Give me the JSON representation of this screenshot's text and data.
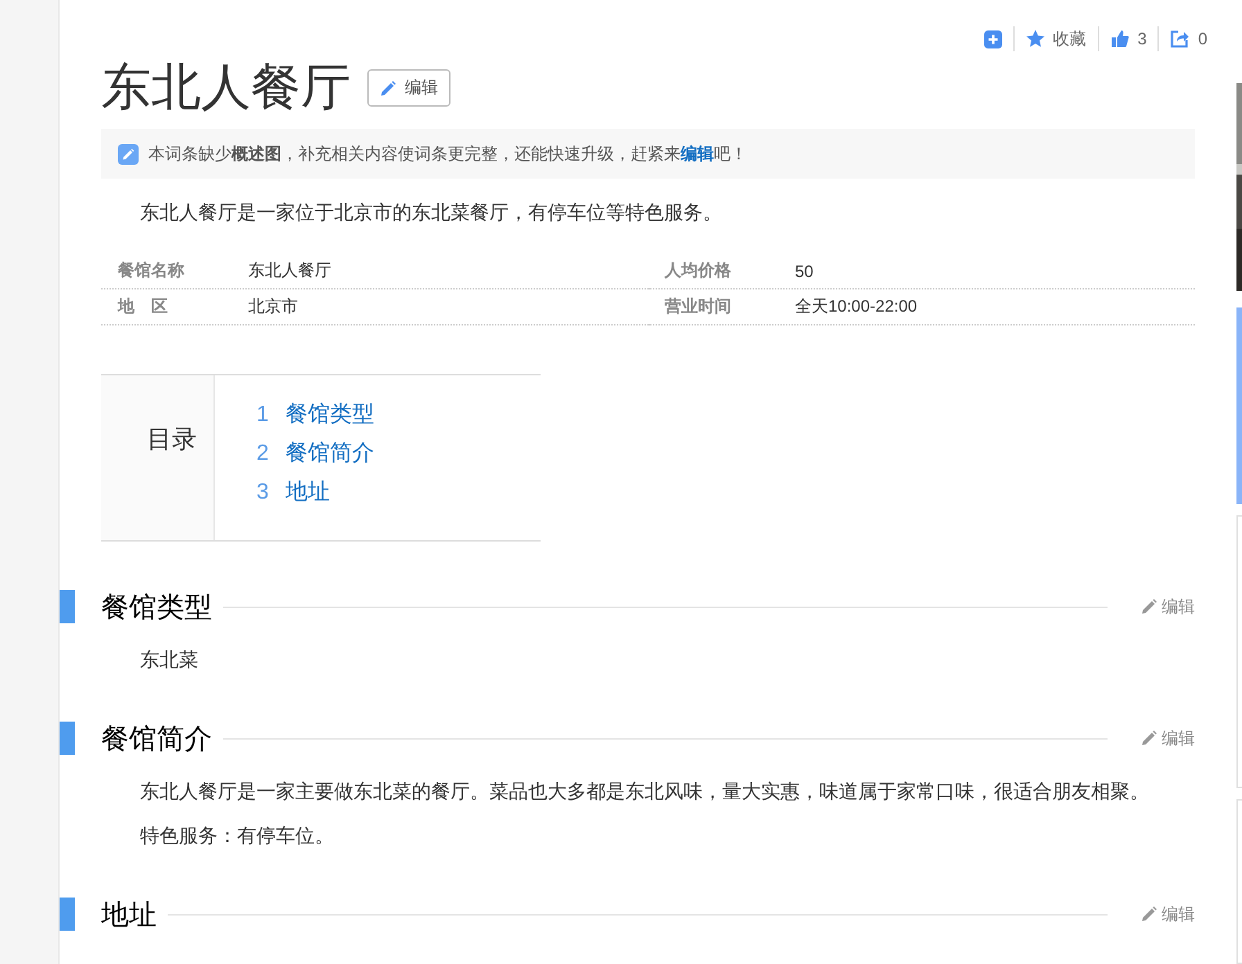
{
  "toolbar": {
    "collect": "收藏",
    "like_count": "3",
    "share_count": "0"
  },
  "title": "东北人餐厅",
  "title_edit": "编辑",
  "notice": "本词条缺少**概述图**，补充相关内容使词条更完整，还能快速升级，赶紧来",
  "notice_link": "编辑",
  "notice_end": "吧！",
  "summary": "东北人餐厅是一家位于北京市的东北菜餐厅，有停车位等特色服务。",
  "info": [
    {
      "label": "餐馆名称",
      "value": "东北人餐厅"
    },
    {
      "label": "人均价格",
      "value": "50"
    },
    {
      "label": "地　区",
      "value": "北京市"
    },
    {
      "label": "营业时间",
      "value": "全天10:00-22:00"
    }
  ],
  "toc": {
    "title": "目录",
    "items": [
      {
        "number": "1",
        "label": "餐馆类型"
      },
      {
        "number": "2",
        "label": "餐馆简介"
      },
      {
        "number": "3",
        "label": "地址"
      }
    ]
  },
  "sections": [
    {
      "title": "餐馆类型",
      "edit": "编辑",
      "paragraphs": [
        "东北菜"
      ]
    },
    {
      "title": "餐馆简介",
      "edit": "编辑",
      "paragraphs": [
        "东北人餐厅是一家主要做东北菜的餐厅。菜品也大多都是东北风味，量大实惠，味道属于家常口味，很适合朋友相聚。",
        "特色服务：有停车位。"
      ]
    },
    {
      "title": "地址",
      "edit": "编辑"
    }
  ]
}
